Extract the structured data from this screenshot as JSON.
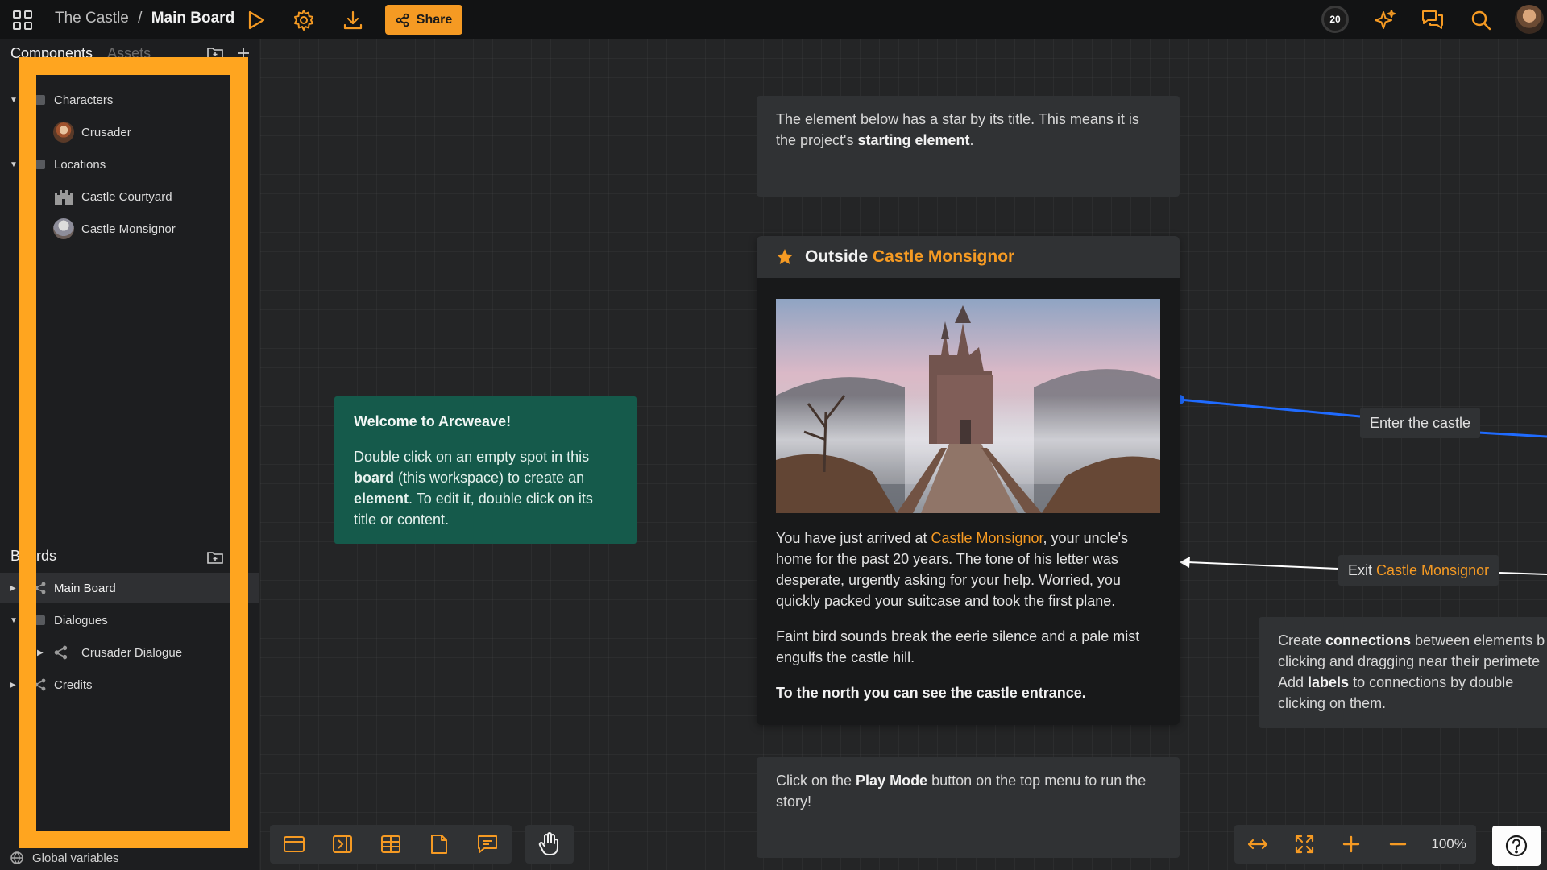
{
  "topbar": {
    "project": "The Castle",
    "separator": "/",
    "board": "Main Board",
    "share_label": "Share",
    "credits_count": "20"
  },
  "sidebar": {
    "tab_components": "Components",
    "tab_assets": "Assets",
    "components": [
      {
        "label": "Characters",
        "type": "folder"
      },
      {
        "label": "Crusader",
        "type": "component"
      },
      {
        "label": "Locations",
        "type": "folder"
      },
      {
        "label": "Castle Courtyard",
        "type": "component"
      },
      {
        "label": "Castle Monsignor",
        "type": "component"
      }
    ],
    "boards_title": "Boards",
    "boards": [
      {
        "label": "Main Board"
      },
      {
        "label": "Dialogues"
      },
      {
        "label": "Crusader Dialogue"
      },
      {
        "label": "Credits"
      }
    ],
    "global_variables": "Global variables"
  },
  "canvas": {
    "note_top": {
      "part1": "The element below has a star by its title. This means it is the project's ",
      "bold": "starting element",
      "part2": "."
    },
    "welcome": {
      "title": "Welcome to Arcweave!",
      "t1": "Double click on an empty spot in this ",
      "b1": "board",
      "t2": " (this workspace) to create an ",
      "b2": "element",
      "t3": ". To edit it, double click on its title or content."
    },
    "element": {
      "title_prefix": "Outside ",
      "title_link": "Castle Monsignor",
      "p1_a": "You have just arrived at ",
      "p1_link": "Castle Monsignor",
      "p1_b": ", your uncle's home for the past 20 years. The tone of his letter was desperate, urgently asking for your help. Worried, you quickly packed your suitcase and took the first plane.",
      "p2": "Faint bird sounds break the eerie silence and a pale mist engulfs the castle hill.",
      "p3": "To the north you can see the castle entrance."
    },
    "connection_enter": "Enter the castle",
    "connection_exit_prefix": "Exit ",
    "connection_exit_link": "Castle Monsignor",
    "note_connections": {
      "t1": "Create ",
      "b1": "connections",
      "t2": " between elements b",
      "t3": "clicking and dragging near their perimete",
      "t4": "Add ",
      "b2": "labels",
      "t5": " to connections by double",
      "t6": "clicking on them."
    },
    "note_bottom": {
      "t1": "Click on the ",
      "b1": "Play Mode",
      "t2": " button on the top menu to run the story!"
    }
  },
  "zoom": {
    "level": "100%"
  },
  "colors": {
    "accent": "#f59a23",
    "highlight": "#ffa51f",
    "welcome_bg": "#155a4b",
    "connection_blue": "#1f6bff"
  }
}
